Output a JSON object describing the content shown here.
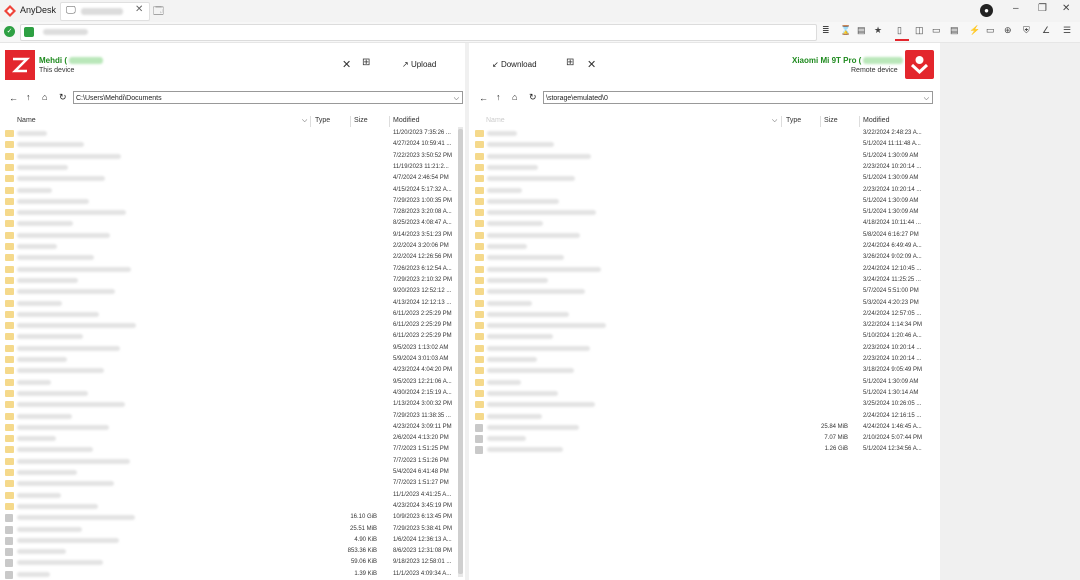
{
  "app": {
    "name": "AnyDesk"
  },
  "window_controls": {
    "avatar": "●",
    "minimize": "–",
    "restore": "❐",
    "close": "✕"
  },
  "toolbar_icons": [
    "≣",
    "⌛",
    "▤",
    "★",
    "▯",
    "◫",
    "▭",
    "▤",
    "⚡",
    "▭",
    "⊕",
    "⛨",
    "∠",
    "☰"
  ],
  "local": {
    "name": "Mehdi (",
    "subtitle": "This device",
    "upload_label": "Upload",
    "path": "C:\\Users\\Mehdi\\Documents",
    "columns": {
      "name": "Name",
      "type": "Type",
      "size": "Size",
      "modified": "Modified"
    },
    "rows": [
      {
        "kind": "folder",
        "size": "",
        "modified": "11/20/2023 7:35:26 ..."
      },
      {
        "kind": "folder",
        "size": "",
        "modified": "4/27/2024 10:59:41 ..."
      },
      {
        "kind": "folder",
        "size": "",
        "modified": "7/22/2023 3:50:52 PM"
      },
      {
        "kind": "folder",
        "size": "",
        "modified": "11/19/2023 11:21:2..."
      },
      {
        "kind": "folder",
        "size": "",
        "modified": "4/7/2024 2:46:54 PM"
      },
      {
        "kind": "folder",
        "size": "",
        "modified": "4/15/2024 5:17:32 A..."
      },
      {
        "kind": "folder",
        "size": "",
        "modified": "7/29/2023 1:00:35 PM"
      },
      {
        "kind": "folder",
        "size": "",
        "modified": "7/28/2023 3:20:08 A..."
      },
      {
        "kind": "folder",
        "size": "",
        "modified": "8/25/2023 4:08:47 A..."
      },
      {
        "kind": "folder",
        "size": "",
        "modified": "9/14/2023 3:51:23 PM"
      },
      {
        "kind": "folder",
        "size": "",
        "modified": "2/2/2024 3:20:06 PM"
      },
      {
        "kind": "folder",
        "size": "",
        "modified": "2/2/2024 12:26:56 PM"
      },
      {
        "kind": "folder",
        "size": "",
        "modified": "7/26/2023 6:12:54 A..."
      },
      {
        "kind": "folder",
        "size": "",
        "modified": "7/29/2023 2:10:32 PM"
      },
      {
        "kind": "folder",
        "size": "",
        "modified": "9/20/2023 12:52:12 ..."
      },
      {
        "kind": "folder",
        "size": "",
        "modified": "4/13/2024 12:12:13 ..."
      },
      {
        "kind": "folder",
        "size": "",
        "modified": "6/11/2023 2:25:29 PM"
      },
      {
        "kind": "folder",
        "size": "",
        "modified": "6/11/2023 2:25:29 PM"
      },
      {
        "kind": "folder",
        "size": "",
        "modified": "6/11/2023 2:25:29 PM"
      },
      {
        "kind": "folder",
        "size": "",
        "modified": "9/5/2023 1:13:02 AM"
      },
      {
        "kind": "folder",
        "size": "",
        "modified": "5/9/2024 3:01:03 AM"
      },
      {
        "kind": "folder",
        "size": "",
        "modified": "4/23/2024 4:04:20 PM"
      },
      {
        "kind": "folder",
        "size": "",
        "modified": "9/5/2023 12:21:06 A..."
      },
      {
        "kind": "folder",
        "size": "",
        "modified": "4/30/2024 2:15:19 A..."
      },
      {
        "kind": "folder",
        "size": "",
        "modified": "1/13/2024 3:00:32 PM"
      },
      {
        "kind": "folder",
        "size": "",
        "modified": "7/29/2023 11:38:35 ..."
      },
      {
        "kind": "folder",
        "size": "",
        "modified": "4/23/2024 3:09:11 PM"
      },
      {
        "kind": "folder",
        "size": "",
        "modified": "2/6/2024 4:13:20 PM"
      },
      {
        "kind": "folder",
        "size": "",
        "modified": "7/7/2023 1:51:25 PM"
      },
      {
        "kind": "folder",
        "size": "",
        "modified": "7/7/2023 1:51:26 PM"
      },
      {
        "kind": "folder",
        "size": "",
        "modified": "5/4/2024 6:41:48 PM"
      },
      {
        "kind": "folder",
        "size": "",
        "modified": "7/7/2023 1:51:27 PM"
      },
      {
        "kind": "folder",
        "size": "",
        "modified": "11/1/2023 4:41:25 A..."
      },
      {
        "kind": "folder",
        "size": "",
        "modified": "4/23/2024 3:45:19 PM"
      },
      {
        "kind": "file",
        "size": "16.10 GiB",
        "modified": "10/9/2023 6:13:45 PM"
      },
      {
        "kind": "file",
        "size": "25.51 MiB",
        "modified": "7/29/2023 5:38:41 PM"
      },
      {
        "kind": "file",
        "size": "4.90 KiB",
        "modified": "1/6/2024 12:36:13 A..."
      },
      {
        "kind": "file",
        "size": "853.36 KiB",
        "modified": "8/6/2023 12:31:08 PM"
      },
      {
        "kind": "file",
        "size": "59.06 KiB",
        "modified": "9/18/2023 12:58:01 ..."
      },
      {
        "kind": "file",
        "size": "1.39 KiB",
        "modified": "11/1/2023 4:09:34 A..."
      }
    ]
  },
  "remote": {
    "name": "Xiaomi Mi 9T Pro (",
    "subtitle": "Remote device",
    "download_label": "Download",
    "path": "\\storage\\emulated\\0",
    "columns": {
      "name": "Name",
      "type": "Type",
      "size": "Size",
      "modified": "Modified"
    },
    "rows": [
      {
        "kind": "folder",
        "size": "",
        "modified": "3/22/2024 2:48:23 A..."
      },
      {
        "kind": "folder",
        "size": "",
        "modified": "5/1/2024 11:11:48 A..."
      },
      {
        "kind": "folder",
        "size": "",
        "modified": "5/1/2024 1:30:09 AM"
      },
      {
        "kind": "folder",
        "size": "",
        "modified": "2/23/2024 10:20:14 ..."
      },
      {
        "kind": "folder",
        "size": "",
        "modified": "5/1/2024 1:30:09 AM"
      },
      {
        "kind": "folder",
        "size": "",
        "modified": "2/23/2024 10:20:14 ..."
      },
      {
        "kind": "folder",
        "size": "",
        "modified": "5/1/2024 1:30:09 AM"
      },
      {
        "kind": "folder",
        "size": "",
        "modified": "5/1/2024 1:30:09 AM"
      },
      {
        "kind": "folder",
        "size": "",
        "modified": "4/18/2024 10:11:44 ..."
      },
      {
        "kind": "folder",
        "size": "",
        "modified": "5/8/2024 6:16:27 PM"
      },
      {
        "kind": "folder",
        "size": "",
        "modified": "2/24/2024 6:49:49 A..."
      },
      {
        "kind": "folder",
        "size": "",
        "modified": "3/26/2024 9:02:09 A..."
      },
      {
        "kind": "folder",
        "size": "",
        "modified": "2/24/2024 12:10:45 ..."
      },
      {
        "kind": "folder",
        "size": "",
        "modified": "3/24/2024 11:25:25 ..."
      },
      {
        "kind": "folder",
        "size": "",
        "modified": "5/7/2024 5:51:00 PM"
      },
      {
        "kind": "folder",
        "size": "",
        "modified": "5/3/2024 4:20:23 PM"
      },
      {
        "kind": "folder",
        "size": "",
        "modified": "2/24/2024 12:57:05 ..."
      },
      {
        "kind": "folder",
        "size": "",
        "modified": "3/22/2024 1:14:34 PM"
      },
      {
        "kind": "folder",
        "size": "",
        "modified": "5/10/2024 1:20:46 A..."
      },
      {
        "kind": "folder",
        "size": "",
        "modified": "2/23/2024 10:20:14 ..."
      },
      {
        "kind": "folder",
        "size": "",
        "modified": "2/23/2024 10:20:14 ..."
      },
      {
        "kind": "folder",
        "size": "",
        "modified": "3/18/2024 9:05:49 PM"
      },
      {
        "kind": "folder",
        "size": "",
        "modified": "5/1/2024 1:30:09 AM"
      },
      {
        "kind": "folder",
        "size": "",
        "modified": "5/1/2024 1:30:14 AM"
      },
      {
        "kind": "folder",
        "size": "",
        "modified": "3/25/2024 10:26:05 ..."
      },
      {
        "kind": "folder",
        "size": "",
        "modified": "2/24/2024 12:16:15 ..."
      },
      {
        "kind": "file",
        "size": "25.84 MiB",
        "modified": "4/24/2024 1:46:45 A..."
      },
      {
        "kind": "file",
        "size": "7.07 MiB",
        "modified": "2/10/2024 5:07:44 PM"
      },
      {
        "kind": "file",
        "size": "1.26 GiB",
        "modified": "5/1/2024 12:34:56 A..."
      }
    ]
  }
}
